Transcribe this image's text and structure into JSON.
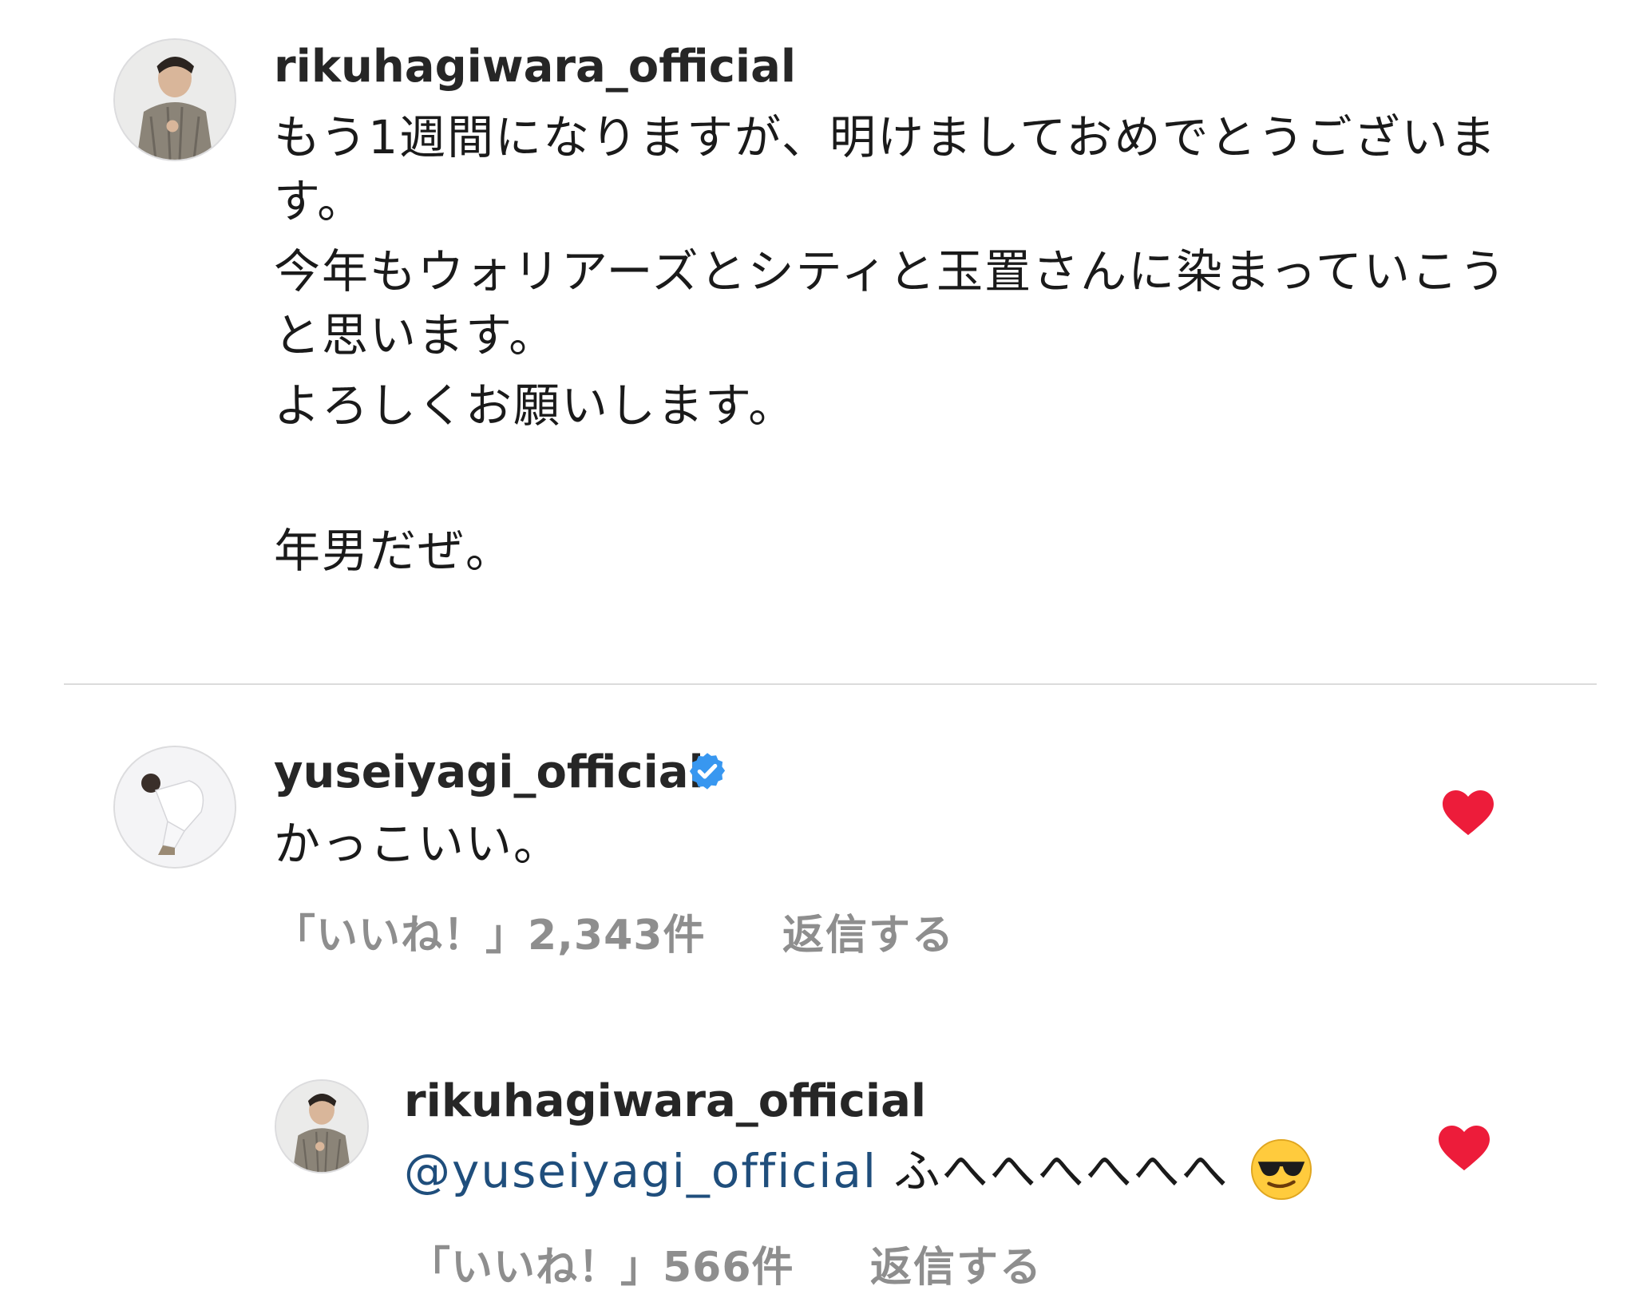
{
  "post": {
    "username": "rikuhagiwara_official",
    "caption_paragraphs": [
      "もう1週間になりますが、明けましておめでとうございます。",
      "今年もウォリアーズとシティと玉置さんに染まっていこうと思います。",
      "よろしくお願いします。"
    ],
    "caption_closing": "年男だぜ。"
  },
  "comments": [
    {
      "username": "yuseiyagi_official",
      "verified": true,
      "text": "かっこいい。",
      "likes_label": "「いいね！」2,343件",
      "reply_label": "返信する",
      "liked": true
    }
  ],
  "replies": [
    {
      "username": "rikuhagiwara_official",
      "mention": "@yuseiyagi_official",
      "text": "ふへへへへへへ",
      "emoji": "smiling-face-with-sunglasses",
      "likes_label": "「いいね！」566件",
      "reply_label": "返信する",
      "liked": true
    }
  ],
  "colors": {
    "heart": "#ed1c3a",
    "verified": "#3897f0",
    "mention": "#1f4e7c",
    "meta": "#8e8e8e",
    "divider": "#dbdbdb"
  }
}
